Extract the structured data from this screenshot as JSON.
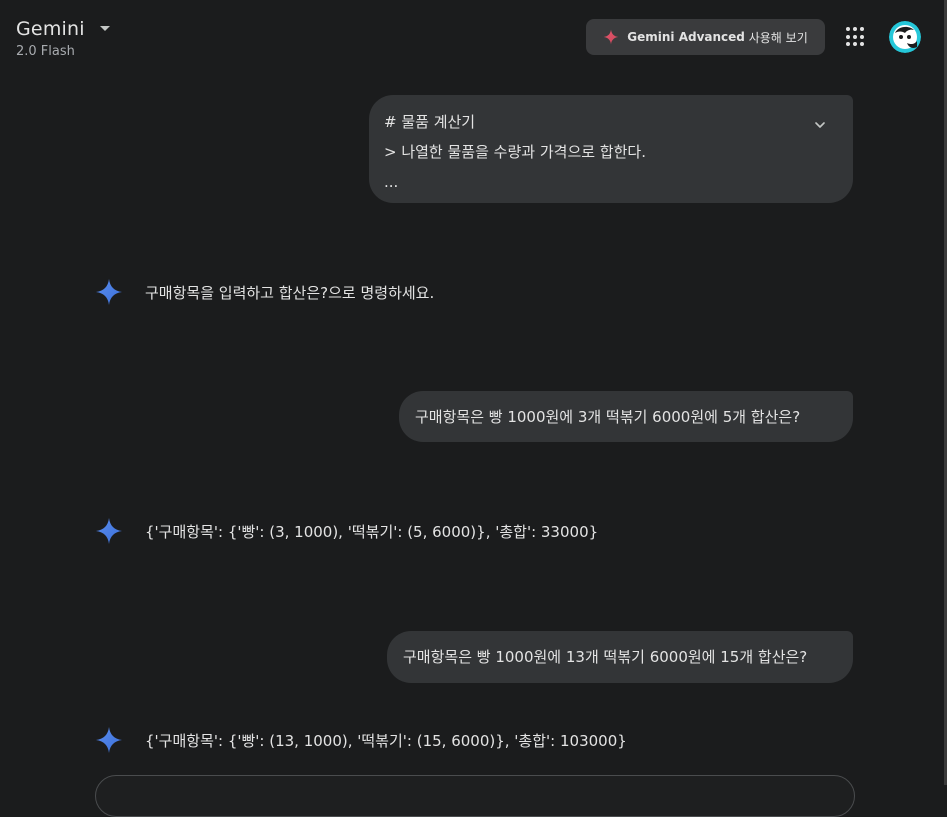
{
  "header": {
    "app_title": "Gemini",
    "model_name": "2.0 Flash",
    "advanced_brand": "Gemini Advanced",
    "advanced_suffix": "사용해 보기",
    "apps_icon": "apps-grid-icon",
    "avatar_icon": "user-avatar"
  },
  "conversation": {
    "prompt_block": {
      "line1": "# 물품 계산기",
      "line2": "> 나열한 물품을 수량과 가격으로 합한다.",
      "line3": "..."
    },
    "reply1": "구매항목을 입력하고 합산은?으로 명령하세요.",
    "user2": "구매항목은 빵 1000원에 3개 떡볶기 6000원에 5개 합산은?",
    "reply2": "{'구매항목': {'빵': (3, 1000), '떡볶기': (5, 6000)}, '총합': 33000}",
    "user3": "구매항목은 빵 1000원에 13개 떡볶기 6000원에 15개 합산은?",
    "reply3": "{'구매항목': {'빵': (13, 1000), '떡볶기': (15, 6000)}, '총합': 103000}"
  },
  "colors": {
    "background": "#1b1c1d",
    "bubble": "#333537",
    "button": "#3a3b3d",
    "text": "#e3e3e3",
    "subtext": "#a8abaf",
    "spark_blue": "#4a90e2",
    "spark_red": "#e8566c"
  }
}
